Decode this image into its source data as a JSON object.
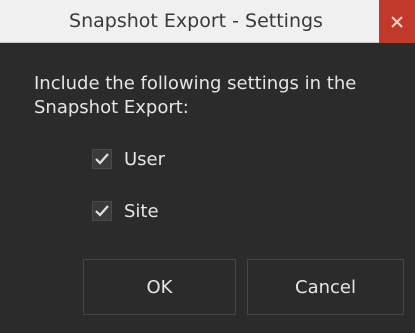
{
  "window": {
    "title": "Snapshot Export - Settings",
    "close_icon": "close-icon",
    "close_color": "#c0392b"
  },
  "content": {
    "instruction": "Include the following settings in the Snapshot Export:",
    "options": [
      {
        "label": "User",
        "checked": true
      },
      {
        "label": "Site",
        "checked": true
      }
    ]
  },
  "buttons": {
    "ok_label": "OK",
    "cancel_label": "Cancel"
  }
}
